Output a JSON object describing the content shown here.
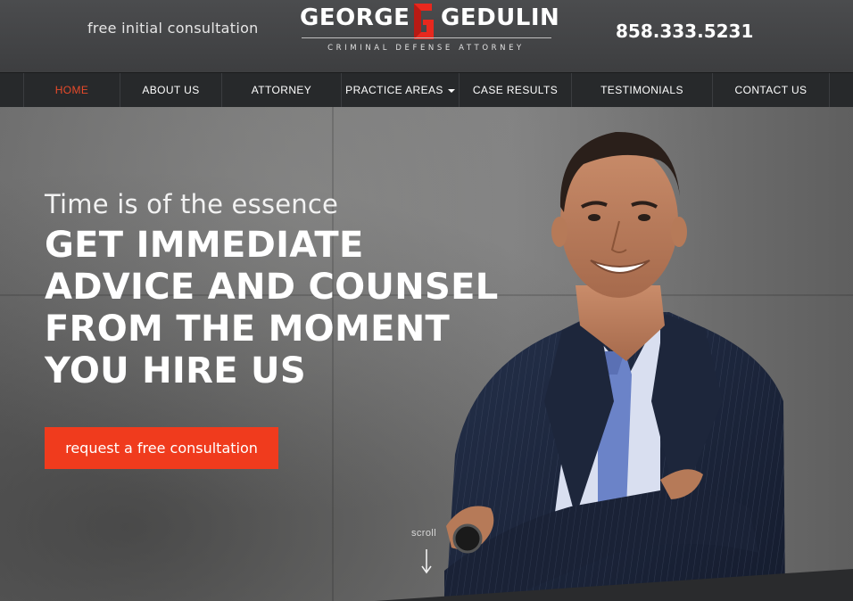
{
  "header": {
    "tagline": "free initial consultation",
    "logo": {
      "first_name": "GEORGE",
      "last_name": "GEDULIN",
      "subtitle": "CRIMINAL DEFENSE ATTORNEY",
      "mark_color": "#e8281e"
    },
    "phone": "858.333.5231"
  },
  "nav": {
    "items": [
      {
        "label": "HOME",
        "active": true
      },
      {
        "label": "ABOUT US",
        "active": false
      },
      {
        "label": "ATTORNEY",
        "active": false
      },
      {
        "label": "PRACTICE AREAS",
        "active": false,
        "has_dropdown": true
      },
      {
        "label": "CASE RESULTS",
        "active": false
      },
      {
        "label": "TESTIMONIALS",
        "active": false
      },
      {
        "label": "CONTACT US",
        "active": false
      }
    ],
    "active_color": "#e84a2a"
  },
  "hero": {
    "kicker": "Time is of the essence",
    "headline_lines": [
      "GET IMMEDIATE",
      "ADVICE AND COUNSEL",
      "FROM THE MOMENT",
      "YOU HIRE US"
    ],
    "cta_label": "request a free consultation",
    "cta_color": "#f03b1d",
    "scroll_label": "scroll"
  }
}
